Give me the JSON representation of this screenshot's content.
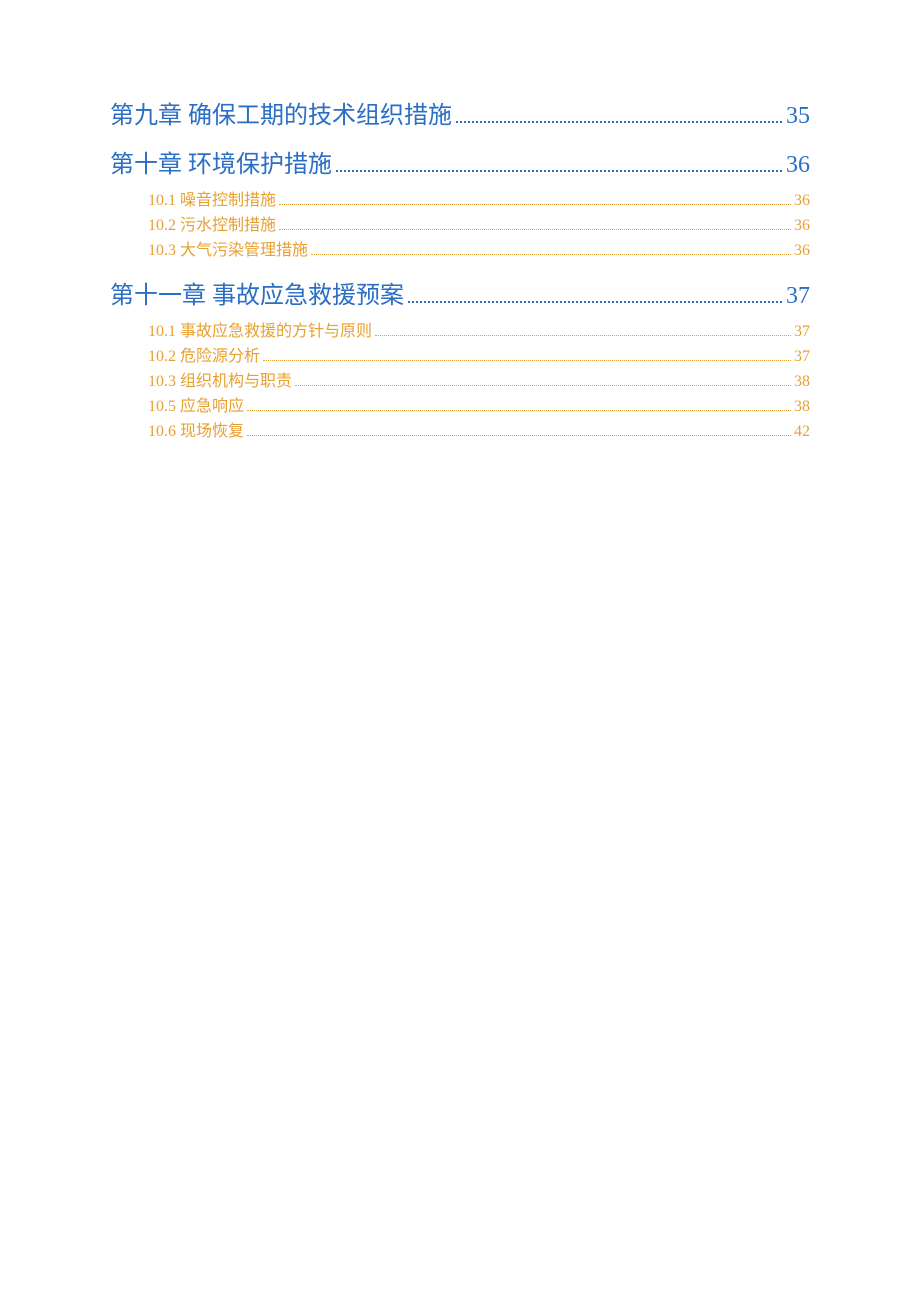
{
  "toc": [
    {
      "type": "chapter",
      "label": "第九章  确保工期的技术组织措施",
      "page": "35",
      "sections": []
    },
    {
      "type": "chapter",
      "label": "第十章  环境保护措施",
      "page": "36",
      "sections": [
        {
          "label": "10.1 噪音控制措施",
          "page": "36"
        },
        {
          "label": "10.2 污水控制措施",
          "page": "36"
        },
        {
          "label": "10.3 大气污染管理措施",
          "page": "36"
        }
      ]
    },
    {
      "type": "chapter",
      "label": "第十一章  事故应急救援预案",
      "page": "37",
      "sections": [
        {
          "label": "10.1 事故应急救援的方针与原则",
          "page": "37"
        },
        {
          "label": "10.2 危险源分析",
          "page": "37"
        },
        {
          "label": "10.3 组织机构与职责",
          "page": "38"
        },
        {
          "label": "10.5 应急响应",
          "page": "38"
        },
        {
          "label": "10.6 现场恢复",
          "page": "42"
        }
      ]
    }
  ]
}
